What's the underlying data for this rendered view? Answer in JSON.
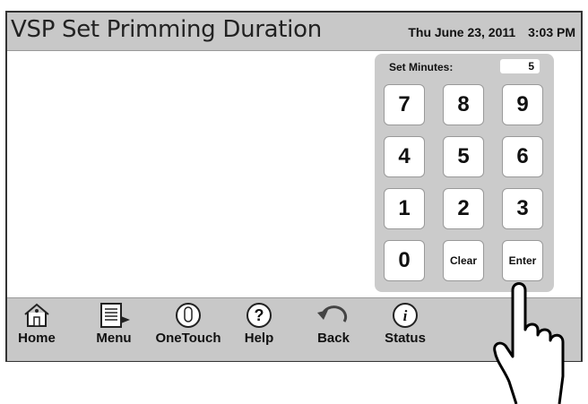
{
  "title": "VSP Set Primming Duration",
  "datetime": {
    "date": "Thu June 23, 2011",
    "time": "3:03 PM"
  },
  "keypad": {
    "label": "Set Minutes:",
    "value": "5",
    "keys": [
      "7",
      "8",
      "9",
      "4",
      "5",
      "6",
      "1",
      "2",
      "3",
      "0",
      "Clear",
      "Enter"
    ]
  },
  "toolbar": {
    "items": [
      {
        "label": "Home",
        "icon": "home-icon"
      },
      {
        "label": "Menu",
        "icon": "menu-icon"
      },
      {
        "label": "OneTouch",
        "icon": "onetouch-icon"
      },
      {
        "label": "Help",
        "icon": "help-icon"
      },
      {
        "label": "Back",
        "icon": "back-icon"
      },
      {
        "label": "Status",
        "icon": "status-icon"
      }
    ]
  },
  "pointer": {
    "icon": "hand-pointer-icon"
  }
}
